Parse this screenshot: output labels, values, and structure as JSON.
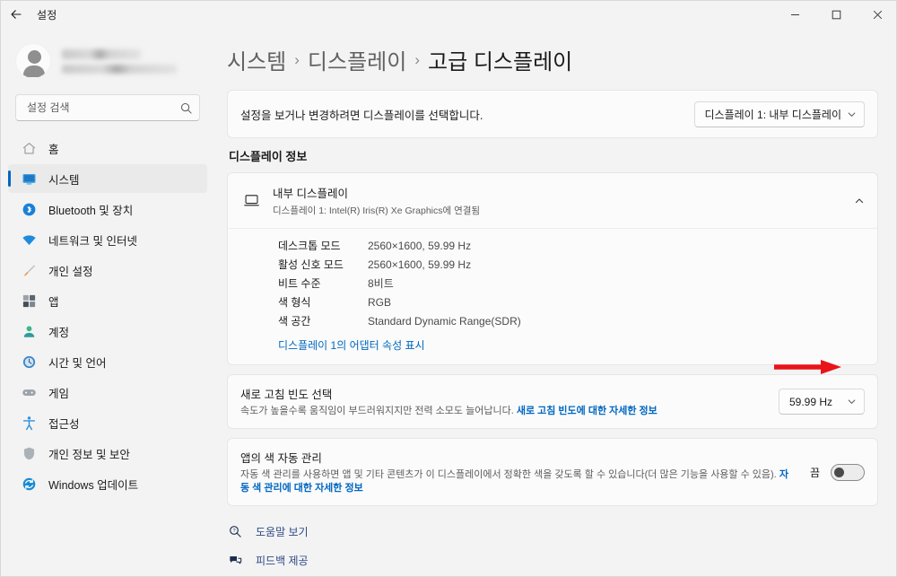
{
  "window": {
    "title": "설정",
    "back_label": "뒤로",
    "minimize_label": "최소화",
    "maximize_label": "최대화",
    "close_label": "닫기"
  },
  "sidebar": {
    "account": {
      "name_redacted": "",
      "email_redacted": ""
    },
    "search": {
      "placeholder": "설정 검색",
      "value": ""
    },
    "items": [
      {
        "label": "홈",
        "icon": "home-icon",
        "selected": false
      },
      {
        "label": "시스템",
        "icon": "system-monitor-icon",
        "selected": true
      },
      {
        "label": "Bluetooth 및 장치",
        "icon": "bluetooth-icon",
        "selected": false
      },
      {
        "label": "네트워크 및 인터넷",
        "icon": "wifi-icon",
        "selected": false
      },
      {
        "label": "개인 설정",
        "icon": "brush-icon",
        "selected": false
      },
      {
        "label": "앱",
        "icon": "apps-icon",
        "selected": false
      },
      {
        "label": "계정",
        "icon": "account-icon",
        "selected": false
      },
      {
        "label": "시간 및 언어",
        "icon": "clock-icon",
        "selected": false
      },
      {
        "label": "게임",
        "icon": "gamepad-icon",
        "selected": false
      },
      {
        "label": "접근성",
        "icon": "accessibility-icon",
        "selected": false
      },
      {
        "label": "개인 정보 및 보안",
        "icon": "shield-icon",
        "selected": false
      },
      {
        "label": "Windows 업데이트",
        "icon": "windows-update-icon",
        "selected": false
      }
    ]
  },
  "breadcrumb": {
    "level1": "시스템",
    "sep1": "›",
    "level2": "디스플레이",
    "sep2": "›",
    "current": "고급 디스플레이"
  },
  "display_selector": {
    "label": "설정을 보거나 변경하려면 디스플레이를 선택합니다.",
    "value": "디스플레이 1: 내부 디스플레이"
  },
  "display_info": {
    "section_title": "디스플레이 정보",
    "device_name": "내부 디스플레이",
    "device_sub": "디스플레이 1: Intel(R) Iris(R) Xe Graphics에 연결됨",
    "expanded": true,
    "rows": [
      {
        "key": "데스크톱 모드",
        "value": "2560×1600, 59.99 Hz"
      },
      {
        "key": "활성 신호 모드",
        "value": "2560×1600, 59.99 Hz"
      },
      {
        "key": "비트 수준",
        "value": "8비트"
      },
      {
        "key": "색 형식",
        "value": "RGB"
      },
      {
        "key": "색 공간",
        "value": "Standard Dynamic Range(SDR)"
      }
    ],
    "adapter_link": "디스플레이 1의 어댑터 속성 표시"
  },
  "refresh_rate": {
    "title": "새로 고침 빈도 선택",
    "desc": "속도가 높을수록 움직임이 부드러워지지만 전력 소모도 늘어납니다.",
    "desc_link": "새로 고침 빈도에 대한 자세한 정보",
    "value": "59.99 Hz"
  },
  "auto_color": {
    "title": "앱의 색 자동 관리",
    "desc": "자동 색 관리를 사용하면 앱 및 기타 콘텐츠가 이 디스플레이에서 정확한 색을 갖도록 할 수 있습니다(더 많은 기능을 사용할 수 있음).",
    "desc_link": "자동 색 관리에 대한 자세한 정보",
    "toggle_state": "끔",
    "toggle_on": false
  },
  "footer_links": [
    {
      "label": "도움말 보기",
      "icon": "help-icon"
    },
    {
      "label": "피드백 제공",
      "icon": "feedback-icon"
    }
  ],
  "annotation": {
    "arrow_color": "#e8141a",
    "points_to": "refresh-rate-dropdown"
  }
}
